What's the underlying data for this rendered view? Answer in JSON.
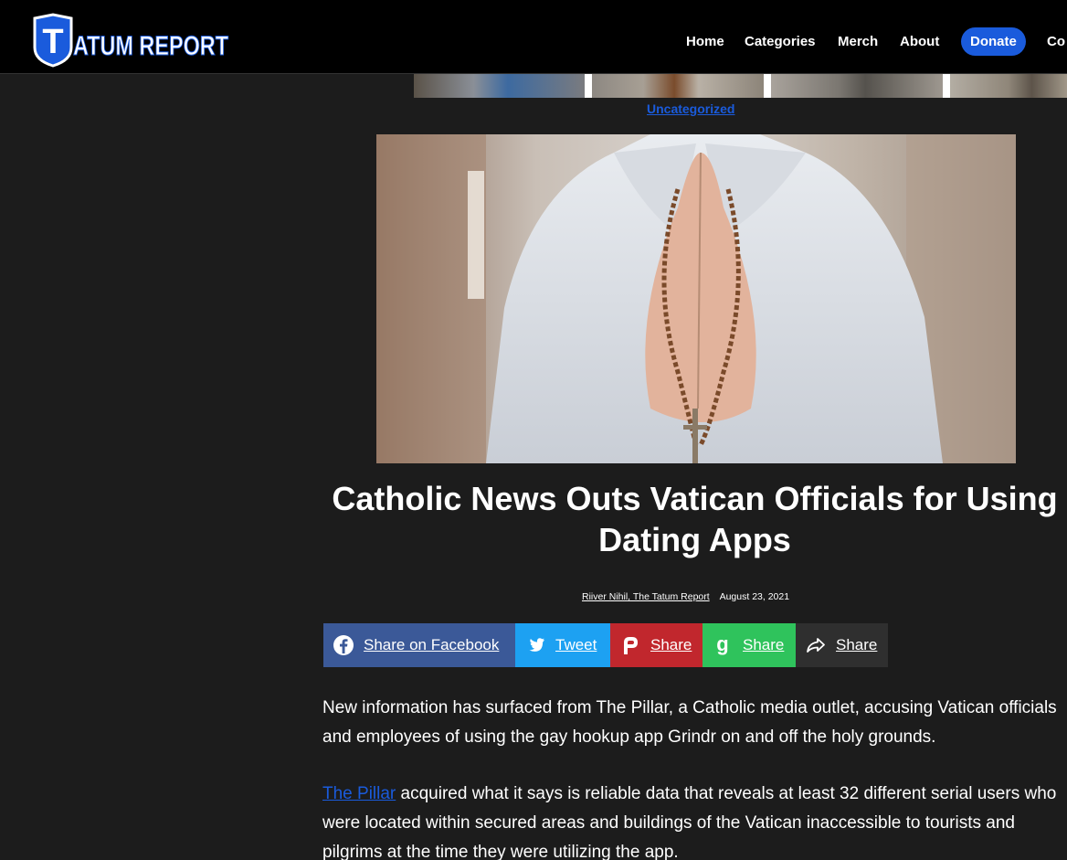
{
  "header": {
    "logo_text": "TATUM REPORT",
    "nav": {
      "home": "Home",
      "categories": "Categories",
      "merch": "Merch",
      "about": "About",
      "donate": "Donate",
      "contact": "Co"
    }
  },
  "article": {
    "category": "Uncategorized",
    "title": "Catholic News Outs Vatican Officials for Using Dating Apps",
    "author": "Riiver Nihil, The Tatum Report",
    "date": "August 23, 2021",
    "share": {
      "facebook": "Share on Facebook",
      "twitter": "Tweet",
      "parler": "Share",
      "gab": "Share",
      "generic": "Share"
    },
    "paragraph_1": "New information has surfaced from The Pillar, a Catholic media outlet, accusing Vatican officials and employees of using the gay hookup app Grindr on and off the holy grounds.",
    "paragraph_2_link": "The Pillar",
    "paragraph_2_rest": " acquired what it says is reliable data that reveals at least 32 different serial users who were located within secured areas and buildings of the Vatican inaccessible to tourists and pilgrims at the time they were utilizing the app."
  },
  "colors": {
    "accent": "#1a5bdc",
    "background": "#1c1c1c",
    "header": "#000000",
    "facebook": "#3b5998",
    "twitter": "#1da1f2",
    "parler": "#c1272d",
    "gab": "#2fc35c"
  }
}
